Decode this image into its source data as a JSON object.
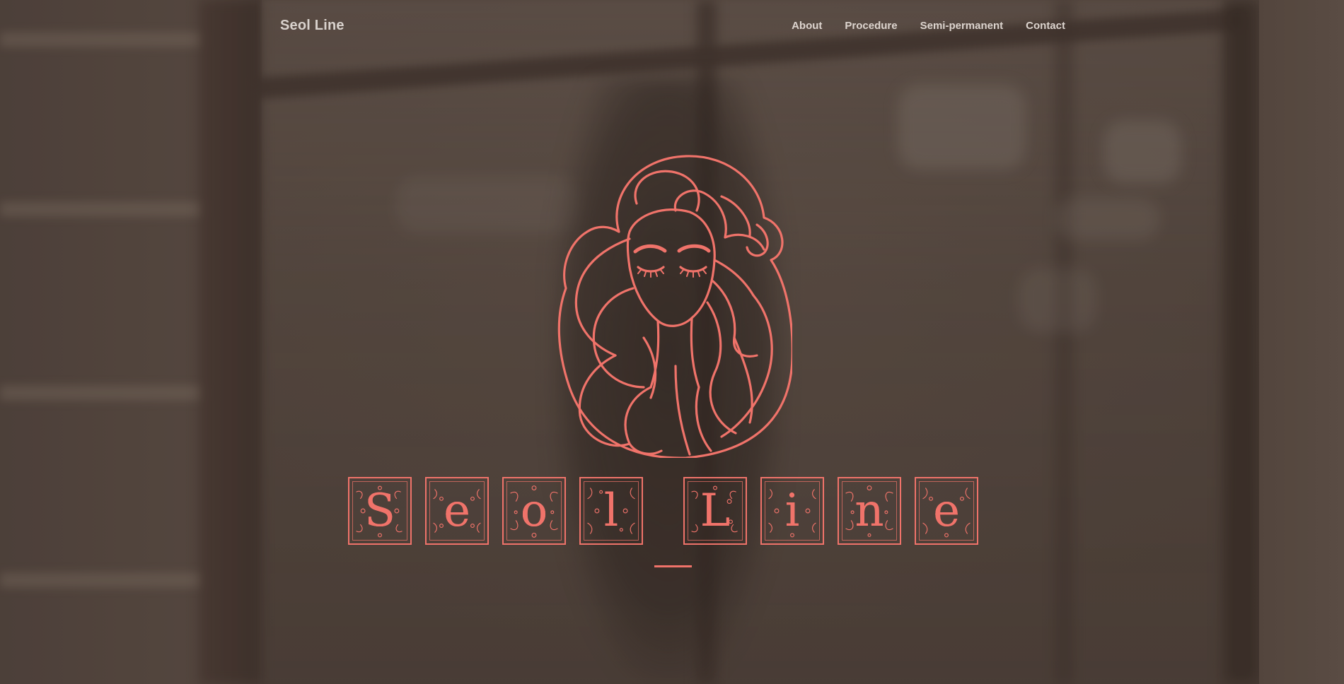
{
  "nav": {
    "brand": "Seol Line",
    "links": [
      {
        "label": "About"
      },
      {
        "label": "Procedure"
      },
      {
        "label": "Semi-permanent"
      },
      {
        "label": "Contact"
      }
    ]
  },
  "hero": {
    "title_letters": [
      "S",
      "e",
      "o",
      "l",
      "L",
      "i",
      "n",
      "e"
    ],
    "logo_icon": "woman-face-hair-logo-icon",
    "accent_color": "#f0736a",
    "overlay_color": "#5a4d45"
  }
}
